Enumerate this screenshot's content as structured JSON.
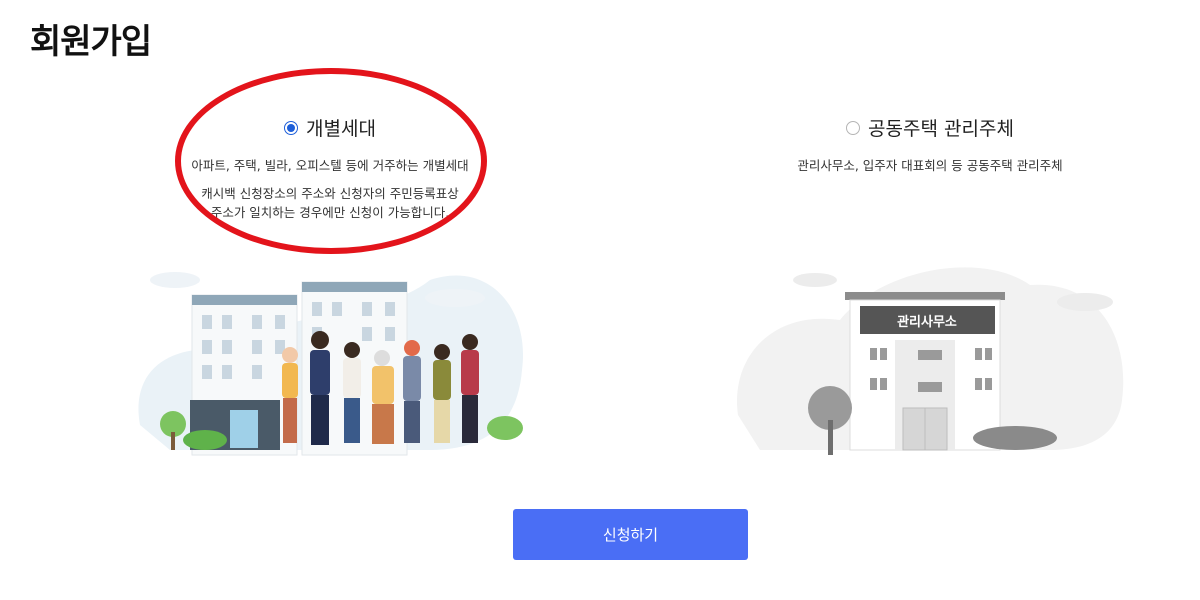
{
  "page": {
    "title": "회원가입"
  },
  "options": [
    {
      "label": "개별세대",
      "selected": true,
      "description": "아파트, 주택, 빌라, 오피스텔 등에 거주하는 개별세대",
      "note_line1": "캐시백 신청장소의 주소와 신청자의 주민등록표상",
      "note_line2": "주소가 일치하는 경우에만 신청이 가능합니다."
    },
    {
      "label": "공동주택 관리주체",
      "selected": false,
      "description": "관리사무소, 입주자 대표회의 등 공동주택 관리주체",
      "building_sign": "관리사무소"
    }
  ],
  "submit": {
    "label": "신청하기"
  },
  "colors": {
    "accent": "#4a6ef5",
    "radio": "#1e5fd9",
    "highlight": "#e3141b"
  }
}
